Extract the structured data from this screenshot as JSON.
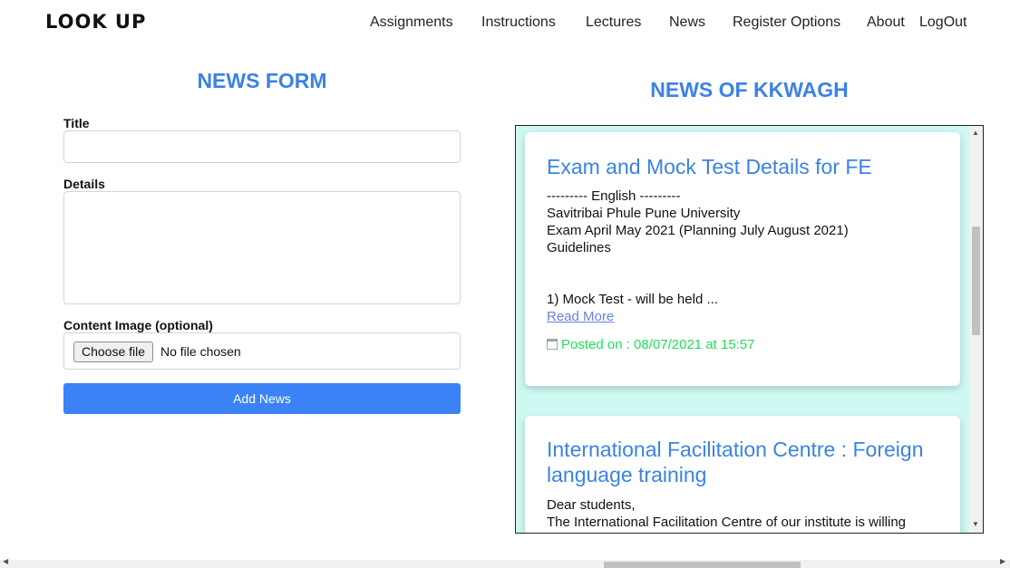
{
  "navbar": {
    "brand": "LOOK UP",
    "links": [
      "Assignments",
      "Instructions",
      "Lectures",
      "News",
      "Register Options",
      "About",
      "LogOut"
    ]
  },
  "form": {
    "heading": "NEWS FORM",
    "title_label": "Title",
    "title_value": "",
    "details_label": "Details",
    "details_value": "",
    "image_label": "Content Image (optional)",
    "choose_file_label": "Choose file",
    "file_status": "No file chosen",
    "submit_label": "Add News"
  },
  "news": {
    "heading": "NEWS OF KKWAGH",
    "items": [
      {
        "title": "Exam and Mock Test Details for FE",
        "body": [
          "--------- English ---------",
          "Savitribai Phule Pune University",
          "Exam April May 2021 (Planning July August 2021)",
          "Guidelines",
          "",
          "",
          "1) Mock Test - will be held ..."
        ],
        "read_more": "Read More",
        "posted": "Posted on : 08/07/2021 at 15:57"
      },
      {
        "title": "International Facilitation Centre : Foreign language training",
        "body": [
          "Dear students,",
          "The International Facilitation Centre of our institute is willing"
        ]
      }
    ]
  },
  "icons": {
    "calendar": "calendar-icon"
  },
  "colors": {
    "accent": "#3b82e6",
    "button": "#3b82f6",
    "posted": "#22e05a",
    "panel_bg": "#cff8f2",
    "link": "#6b7fe0"
  }
}
